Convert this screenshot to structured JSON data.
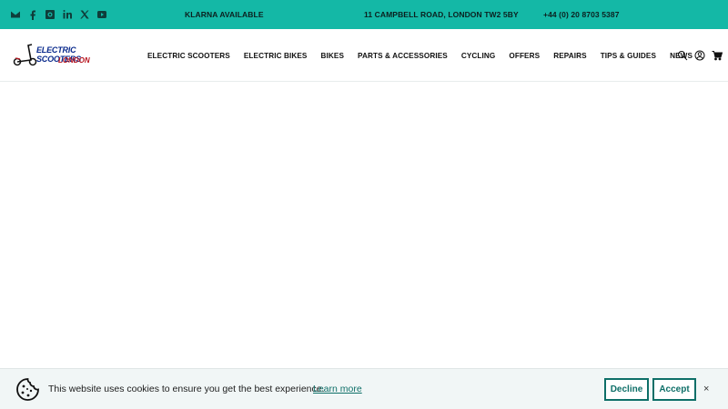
{
  "topbar": {
    "promo": "KLARNA AVAILABLE",
    "address": "11 CAMPBELL ROAD, LONDON TW2 5BY",
    "phone": "+44 (0) 20 8703 5387",
    "social_icons": [
      "mail-icon",
      "facebook-icon",
      "instagram-icon",
      "linkedin-icon",
      "x-icon",
      "youtube-icon"
    ],
    "bg_color": "#14b8a6"
  },
  "logo": {
    "line1": "ELECTRIC SCOOTERS",
    "line2": "LONDON"
  },
  "nav": {
    "items": [
      "ELECTRIC SCOOTERS",
      "ELECTRIC BIKES",
      "BIKES",
      "PARTS & ACCESSORIES",
      "CYCLING",
      "OFFERS",
      "REPAIRS",
      "TIPS & GUIDES",
      "NEWS"
    ]
  },
  "header_icons": [
    "search-icon",
    "account-icon",
    "cart-icon"
  ],
  "cookie": {
    "message": "This website uses cookies to ensure you get the best experience.",
    "learn_more": "Learn more",
    "decline": "Decline",
    "accept": "Accept",
    "close": "×",
    "accent_color": "#0e6f68"
  }
}
